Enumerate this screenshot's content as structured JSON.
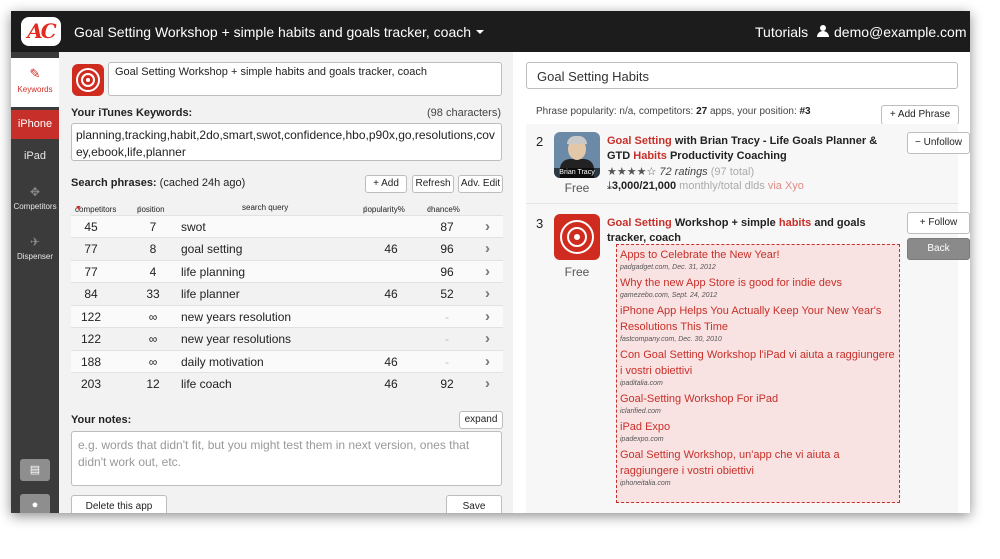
{
  "header": {
    "logo_text": "AC",
    "app_title": "Goal Setting Workshop + simple habits and goals tracker, coach",
    "tutorials": "Tutorials",
    "user_email": "demo@example.com"
  },
  "sidebar": {
    "keywords_icon": "pencil-icon",
    "keywords_label": "Keywords",
    "iphone_label": "iPhone",
    "ipad_label": "iPad",
    "competitors_label": "Competitors",
    "dispenser_label": "Dispenser",
    "book_icon": "book-icon",
    "chat_icon": "chat-icon"
  },
  "left": {
    "app_name": "Goal Setting Workshop + simple habits and goals tracker, coach",
    "keywords_label": "Your iTunes Keywords:",
    "keywords_count": "(98 characters)",
    "keywords_value": "planning,tracking,habit,2do,smart,swot,confidence,hbo,p90x,go,resolutions,covey,ebook,life,planner",
    "search_phrases_label": "Search phrases:",
    "search_phrases_note": "(cached 24h ago)",
    "add_label": "+ Add",
    "refresh_label": "Refresh",
    "adv_edit_label": "Adv. Edit",
    "columns": {
      "competitors": "competitors",
      "position": "position",
      "query": "search query",
      "popularity": "popularity%",
      "chance": "chance%"
    },
    "rows": [
      {
        "competitors": "45",
        "position": "7",
        "query": "swot",
        "popularity": "",
        "chance": "87"
      },
      {
        "competitors": "77",
        "position": "8",
        "query": "goal setting",
        "popularity": "46",
        "chance": "96"
      },
      {
        "competitors": "77",
        "position": "4",
        "query": "life planning",
        "popularity": "",
        "chance": "96"
      },
      {
        "competitors": "84",
        "position": "33",
        "query": "life planner",
        "popularity": "46",
        "chance": "52"
      },
      {
        "competitors": "122",
        "position": "∞",
        "query": "new years resolution",
        "popularity": "",
        "chance": "-"
      },
      {
        "competitors": "122",
        "position": "∞",
        "query": "new year resolutions",
        "popularity": "",
        "chance": "-"
      },
      {
        "competitors": "188",
        "position": "∞",
        "query": "daily motivation",
        "popularity": "46",
        "chance": "-"
      },
      {
        "competitors": "203",
        "position": "12",
        "query": "life coach",
        "popularity": "46",
        "chance": "92"
      }
    ],
    "notes_label": "Your notes:",
    "expand_label": "expand",
    "notes_placeholder": "e.g. words that didn't fit, but you might test them in next version, ones that didn't work out, etc.",
    "delete_label": "Delete this app",
    "save_label": "Save"
  },
  "right": {
    "search_value": "Goal Setting Habits",
    "phrase_popularity_prefix": "Phrase popularity: n/a, competitors:",
    "competitors_count": "27",
    "competitors_suffix": "apps, your position:",
    "position_value": "#3",
    "add_phrase_label": "+ Add Phrase",
    "competitor_2": {
      "rank": "2",
      "title_hl1": "Goal Setting",
      "title_mid": " with Brian Tracy - Life Goals Planner & GTD ",
      "title_hl2": "Habits",
      "title_end": " Productivity Coaching",
      "icon_caption": "Brian Tracy",
      "stars": "★★★★☆",
      "ratings": "72 ratings",
      "total": "(97 total)",
      "downloads": "3,000/21,000",
      "downloads_note": "monthly/total dlds",
      "via": "via Xyo",
      "price": "Free",
      "unfollow_label": "− Unfollow"
    },
    "competitor_3": {
      "rank": "3",
      "title_hl1": "Goal Setting",
      "title_mid": " Workshop + simple ",
      "title_hl2": "habits",
      "title_end": " and goals tracker, coach",
      "price": "Free",
      "follow_label": "+ Follow",
      "back_label": "Back"
    },
    "news": [
      {
        "title": "Apps to Celebrate the New Year!",
        "source": "padgadget.com, Dec. 31, 2012"
      },
      {
        "title": "Why the new App Store is good for indie devs",
        "source": "gamezebo.com, Sept. 24, 2012"
      },
      {
        "title": "iPhone App Helps You Actually Keep Your New Year's Resolutions This Time",
        "source": "fastcompany.com, Dec. 30, 2010"
      },
      {
        "title": "Con Goal Setting Workshop l'iPad vi aiuta a raggiungere i vostri obiettivi",
        "source": "ipaditalia.com"
      },
      {
        "title": "Goal-Setting Workshop For iPad",
        "source": "iclarified.com"
      },
      {
        "title": "iPad Expo",
        "source": "ipadexpo.com"
      },
      {
        "title": "Goal Setting Workshop, un'app che vi aiuta a raggiungere i vostri obiettivi",
        "source": "iphoneitalia.com"
      }
    ]
  },
  "colors": {
    "accent": "#c7302a",
    "topbar": "#1c1c1c",
    "sidebar": "#3b3b3b"
  }
}
